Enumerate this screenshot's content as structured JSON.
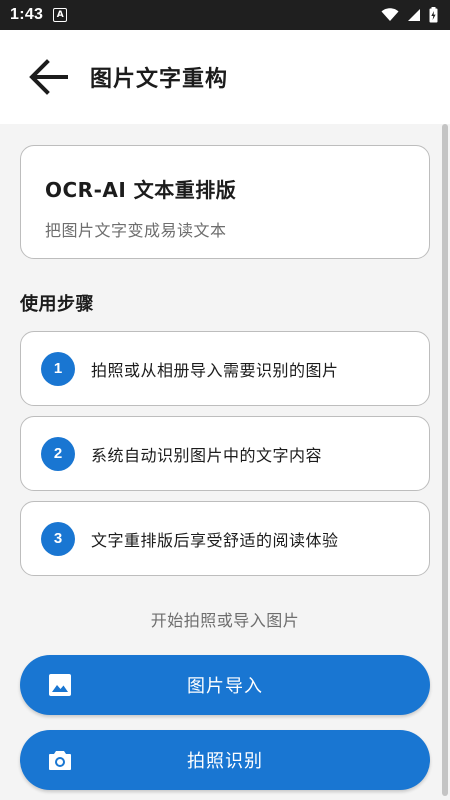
{
  "status_bar": {
    "time": "1:43",
    "notification_badge": "A",
    "icons": [
      "wifi-icon",
      "signal-icon",
      "battery-charging-icon"
    ]
  },
  "app_bar": {
    "back_icon": "arrow-left-icon",
    "title": "图片文字重构"
  },
  "intro_card": {
    "title": "OCR-AI 文本重排版",
    "subtitle": "把图片文字变成易读文本"
  },
  "steps": {
    "title": "使用步骤",
    "items": [
      {
        "number": "1",
        "text": "拍照或从相册导入需要识别的图片"
      },
      {
        "number": "2",
        "text": "系统自动识别图片中的文字内容"
      },
      {
        "number": "3",
        "text": "文字重排版后享受舒适的阅读体验"
      }
    ]
  },
  "hint": "开始拍照或导入图片",
  "actions": {
    "import": {
      "label": "图片导入",
      "icon": "image-icon"
    },
    "camera": {
      "label": "拍照识别",
      "icon": "camera-icon"
    }
  },
  "colors": {
    "accent": "#1976d2",
    "status_bar": "#1f1f1f",
    "background": "#f4f4f4",
    "card_border": "#bdbdbd"
  }
}
